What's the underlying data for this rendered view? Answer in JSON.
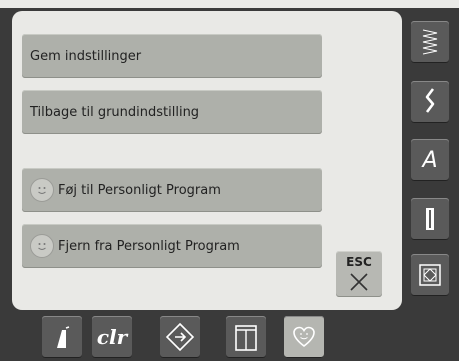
{
  "settings_menu": {
    "save_label": "Gem indstillinger",
    "reset_label": "Tilbage til grundindstilling",
    "add_label": "Føj til Personligt Program",
    "remove_label": "Fjern fra Personligt Program",
    "esc_label": "ESC"
  },
  "sidebar": {
    "items": [
      {
        "icon": "zigzag-stitch-icon"
      },
      {
        "icon": "decorative-stitch-icon"
      },
      {
        "icon": "alphabet-icon",
        "label": "A"
      },
      {
        "icon": "buttonhole-icon"
      },
      {
        "icon": "quilt-icon"
      },
      {
        "icon": "sewing-foot-icon"
      }
    ]
  },
  "bottom_toolbar": {
    "clr_label": "clr",
    "items": [
      "stitch-setting-icon",
      "clr-button",
      "navigation-icon",
      "tutorial-icon",
      "personal-program-icon"
    ]
  },
  "colors": {
    "background": "#3a3a3a",
    "panel": "#e9e9e6",
    "button": "#aeb0aa",
    "dark_button": "#5a5a5a"
  }
}
